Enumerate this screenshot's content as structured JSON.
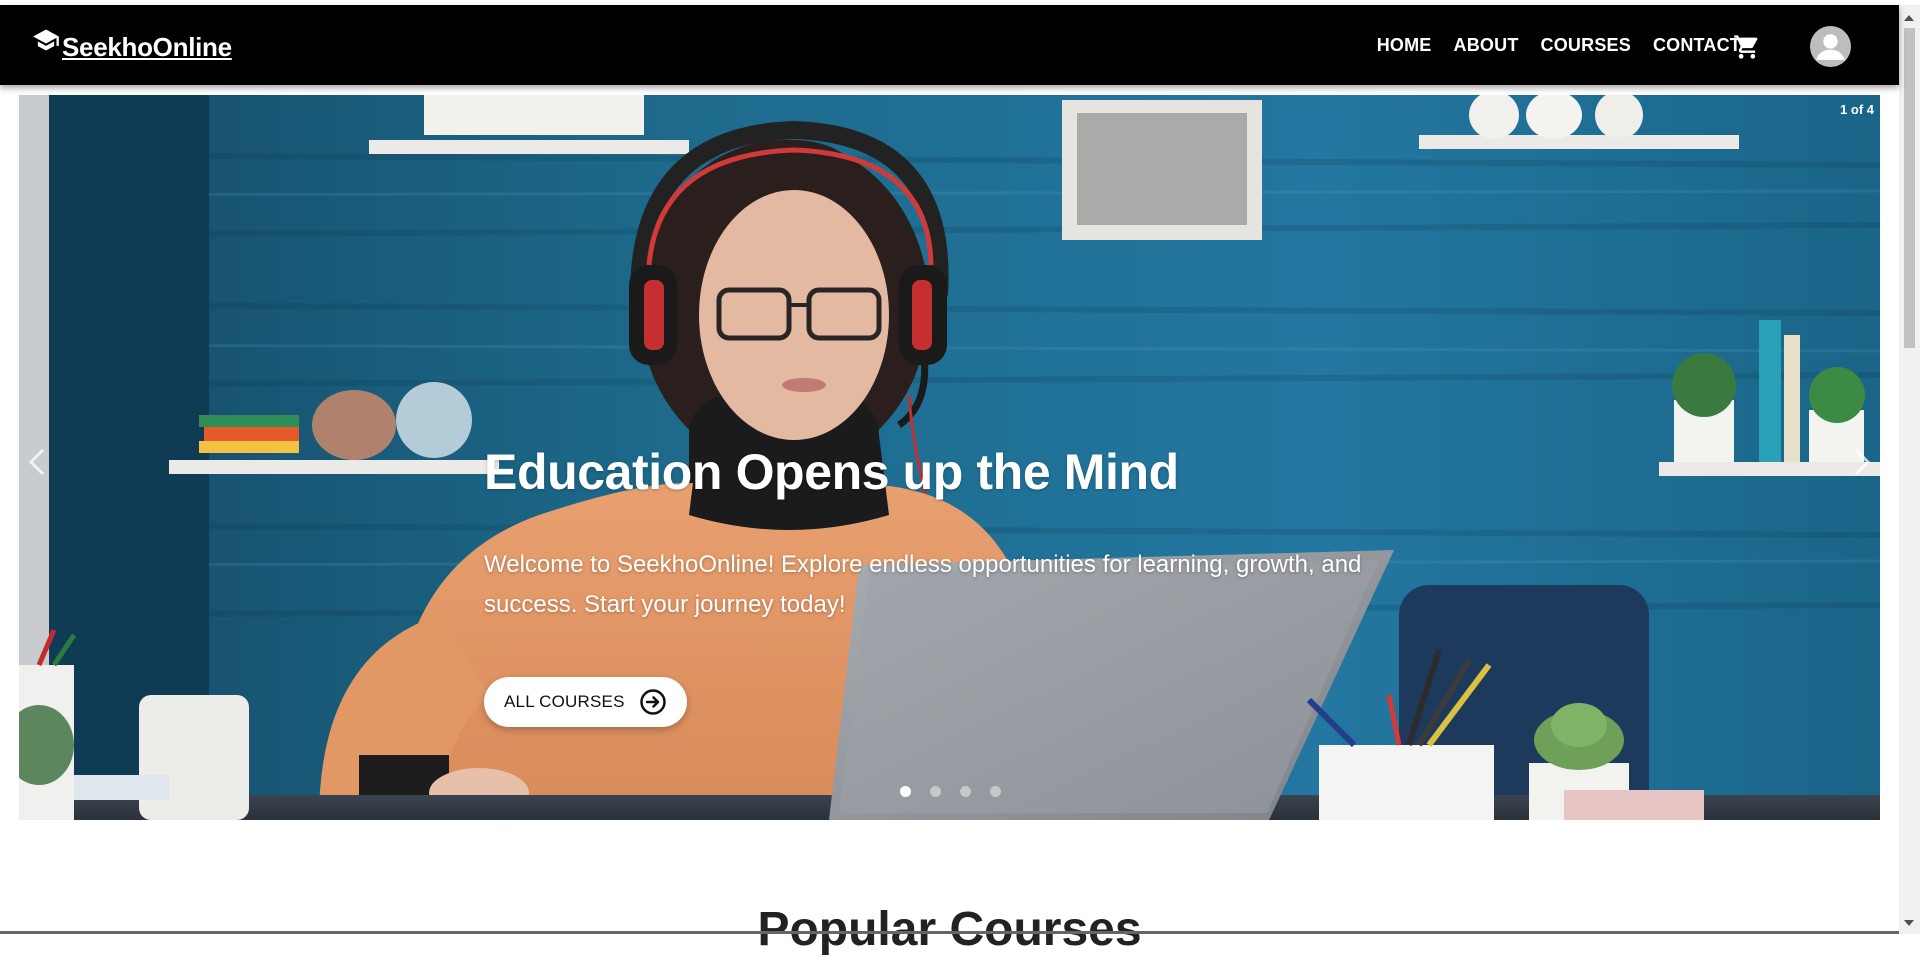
{
  "brand": {
    "name": "SeekhoOnline",
    "icon": "graduation-cap-icon"
  },
  "nav": {
    "links": [
      "HOME",
      "ABOUT",
      "COURSES",
      "CONTACT"
    ],
    "cart_icon": "shopping-cart-icon",
    "avatar_icon": "user-avatar-icon"
  },
  "hero": {
    "counter": "1 of 4",
    "title": "Education Opens up the Mind",
    "subtitle": "Welcome to SeekhoOnline! Explore endless opportunities for learning, growth, and success. Start your journey today!",
    "button_label": "ALL COURSES",
    "button_icon": "arrow-right-circle-icon",
    "slides_total": 4,
    "active_slide": 1
  },
  "section": {
    "title": "Popular Courses"
  },
  "colors": {
    "navbar": "#000000",
    "text_light": "#ffffff",
    "wall_blue": "#1f6e8e",
    "sweater": "#e09060"
  }
}
